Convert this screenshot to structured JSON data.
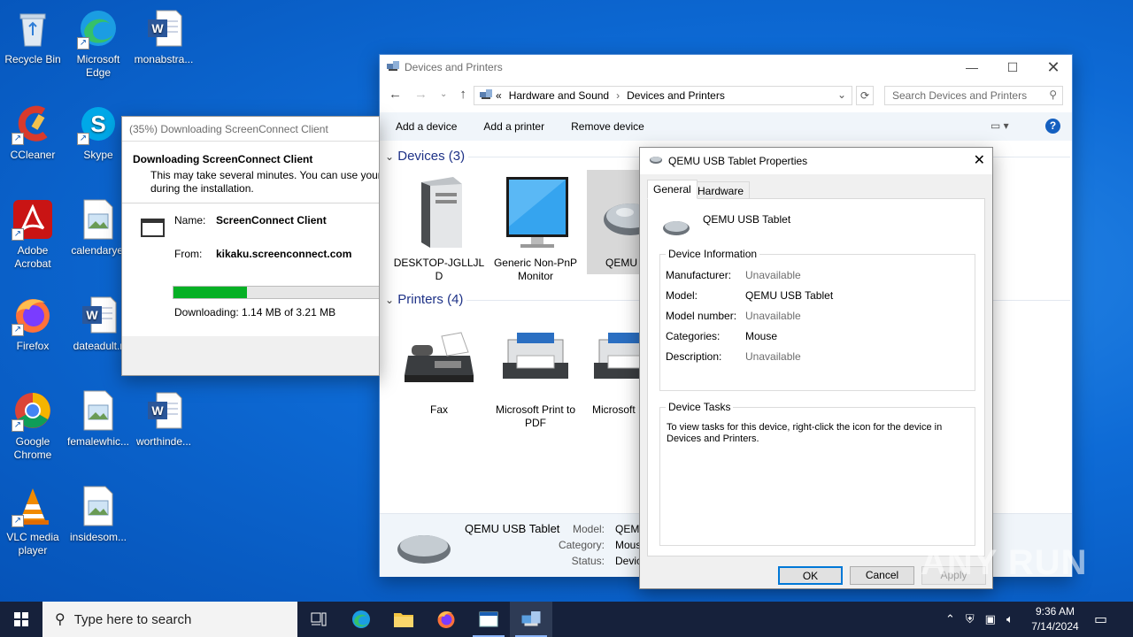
{
  "desktop": {
    "icons": [
      {
        "label": "Recycle Bin",
        "icon": "recycle-bin-icon"
      },
      {
        "label": "Microsoft Edge",
        "icon": "edge-icon"
      },
      {
        "label": "monabstra...",
        "icon": "word-doc-icon"
      },
      {
        "label": "CCleaner",
        "icon": "ccleaner-icon"
      },
      {
        "label": "Skype",
        "icon": "skype-icon"
      },
      {
        "label": "Adobe Acrobat",
        "icon": "acrobat-icon"
      },
      {
        "label": "calendaryel",
        "icon": "image-file-icon"
      },
      {
        "label": "Firefox",
        "icon": "firefox-icon"
      },
      {
        "label": "dateadult.r",
        "icon": "word-doc-icon"
      },
      {
        "label": "Google Chrome",
        "icon": "chrome-icon"
      },
      {
        "label": "femalewhic...",
        "icon": "image-file-icon"
      },
      {
        "label": "worthinde...",
        "icon": "word-doc-icon"
      },
      {
        "label": "VLC media player",
        "icon": "vlc-icon"
      },
      {
        "label": "insidesom...",
        "icon": "image-file-icon"
      }
    ]
  },
  "download_dialog": {
    "title": "(35%) Downloading ScreenConnect Client",
    "heading": "Downloading ScreenConnect Client",
    "subtext_line1": "This may take several minutes. You can use your",
    "subtext_line2": "during the installation.",
    "name_label": "Name:",
    "name_value": "ScreenConnect Client",
    "from_label": "From:",
    "from_value": "kikaku.screenconnect.com",
    "progress": 0.35,
    "status": "Downloading: 1.14 MB of 3.21 MB",
    "accent": "#06b025"
  },
  "devices_window": {
    "title": "Devices and Printers",
    "breadcrumb": [
      "Hardware and Sound",
      "Devices and Printers"
    ],
    "breadcrumb_prefix": "«",
    "search_placeholder": "Search Devices and Printers",
    "commands": [
      "Add a device",
      "Add a printer",
      "Remove device"
    ],
    "help": "?",
    "devices_group": "Devices (3)",
    "devices": [
      {
        "label": "DESKTOP-JGLLJL D",
        "icon": "computer-tower-icon"
      },
      {
        "label": "Generic Non-PnP Monitor",
        "icon": "monitor-icon"
      },
      {
        "label": "QEMU USB",
        "icon": "mouse-icon"
      }
    ],
    "printers_group": "Printers (4)",
    "printers": [
      {
        "label": "Fax",
        "icon": "fax-icon"
      },
      {
        "label": "Microsoft Print to PDF",
        "icon": "printer-icon"
      },
      {
        "label": "Microsoft Document",
        "icon": "printer-icon"
      }
    ],
    "details": {
      "name": "QEMU USB Tablet",
      "model_label": "Model:",
      "model_value": "QEMU",
      "category_label": "Category:",
      "category_value": "Mous",
      "status_label": "Status:",
      "status_value": "Devic"
    }
  },
  "properties": {
    "title": "QEMU USB Tablet Properties",
    "tabs": [
      "General",
      "Hardware"
    ],
    "device_name": "QEMU USB Tablet",
    "info_legend": "Device Information",
    "fields": [
      {
        "label": "Manufacturer:",
        "value": "Unavailable",
        "muted": true
      },
      {
        "label": "Model:",
        "value": "QEMU USB Tablet",
        "muted": false
      },
      {
        "label": "Model number:",
        "value": "Unavailable",
        "muted": true
      },
      {
        "label": "Categories:",
        "value": "Mouse",
        "muted": false
      },
      {
        "label": "Description:",
        "value": "Unavailable",
        "muted": true
      }
    ],
    "tasks_legend": "Device Tasks",
    "tasks_text": "To view tasks for this device, right-click the icon for the device in Devices and Printers.",
    "ok": "OK",
    "cancel": "Cancel",
    "apply": "Apply"
  },
  "taskbar": {
    "search_placeholder": "Type here to search",
    "time": "9:36 AM",
    "date": "7/14/2024"
  },
  "watermark": "ANY RUN"
}
